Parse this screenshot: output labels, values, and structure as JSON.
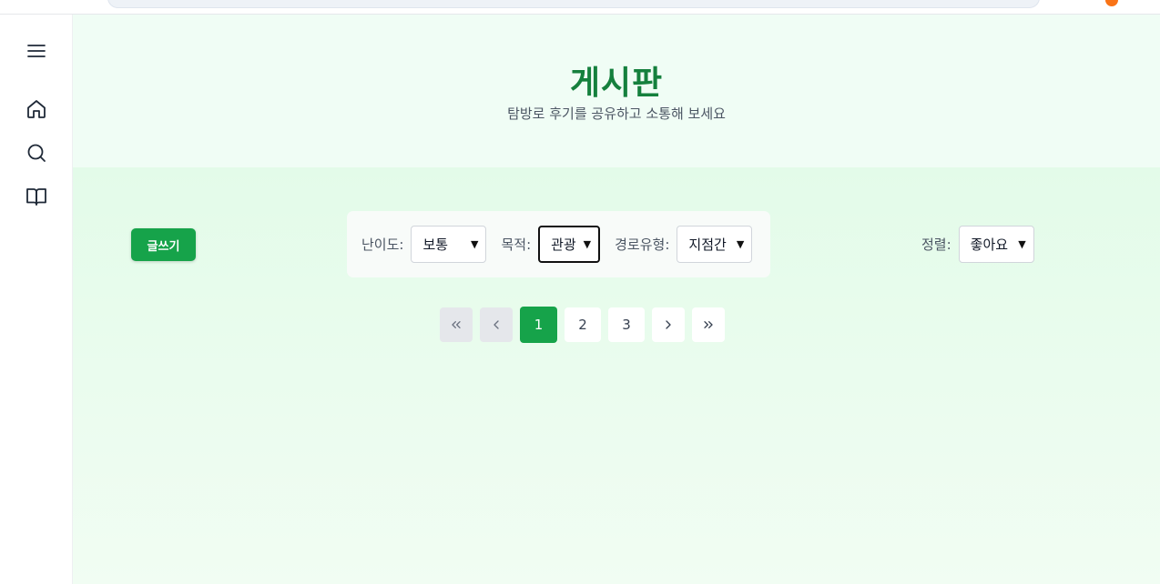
{
  "header": {
    "title": "게시판",
    "subtitle": "탐방로 후기를 공유하고 소통해 보세요"
  },
  "sidebar": {
    "items": [
      {
        "name": "menu",
        "icon": "menu-icon"
      },
      {
        "name": "home",
        "icon": "home-icon"
      },
      {
        "name": "search",
        "icon": "search-icon"
      },
      {
        "name": "book",
        "icon": "book-icon"
      }
    ]
  },
  "toolbar": {
    "write_label": "글쓰기"
  },
  "filters": {
    "difficulty": {
      "label": "난이도:",
      "value": "보통"
    },
    "purpose": {
      "label": "목적:",
      "value": "관광"
    },
    "route_type": {
      "label": "경로유형:",
      "value": "지점간"
    }
  },
  "sort": {
    "label": "정렬:",
    "value": "좋아요"
  },
  "pagination": {
    "pages": [
      "1",
      "2",
      "3"
    ],
    "current": "1"
  },
  "colors": {
    "accent": "#16a34a",
    "title": "#15803d",
    "background": "#f0fdf5"
  }
}
